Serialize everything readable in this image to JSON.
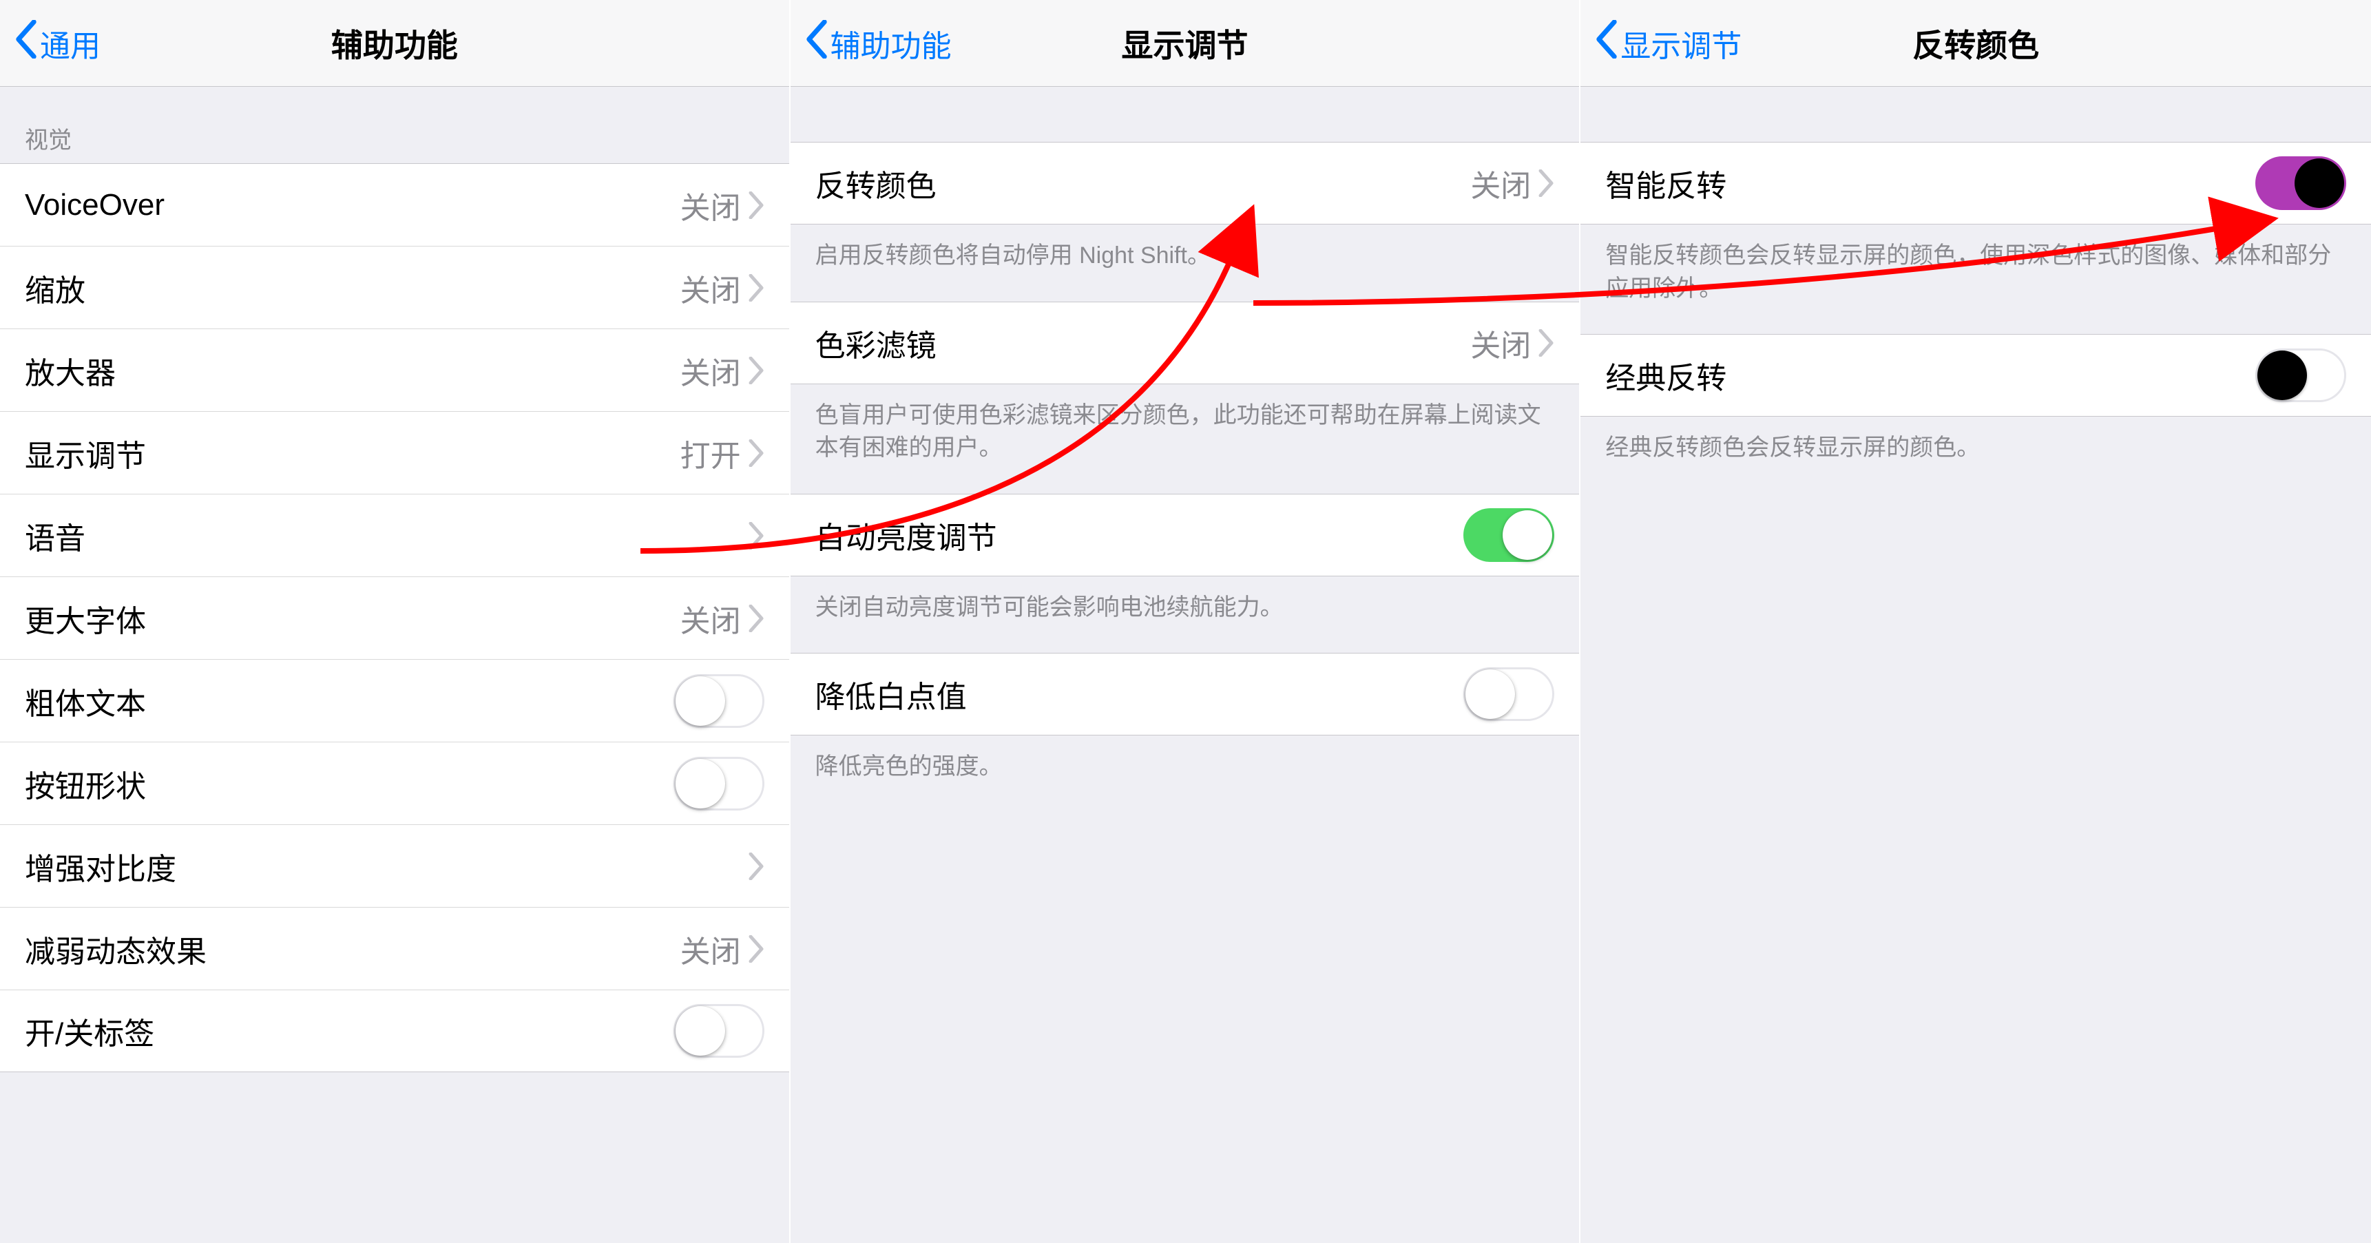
{
  "panel1": {
    "back": "通用",
    "title": "辅助功能",
    "vision_header": "视觉",
    "rows": {
      "voiceover": {
        "label": "VoiceOver",
        "value": "关闭"
      },
      "zoom": {
        "label": "缩放",
        "value": "关闭"
      },
      "magnifier": {
        "label": "放大器",
        "value": "关闭"
      },
      "display": {
        "label": "显示调节",
        "value": "打开"
      },
      "speech": {
        "label": "语音",
        "value": ""
      },
      "larger": {
        "label": "更大字体",
        "value": "关闭"
      },
      "bold": {
        "label": "粗体文本"
      },
      "buttonshape": {
        "label": "按钮形状"
      },
      "contrast": {
        "label": "增强对比度"
      },
      "motion": {
        "label": "减弱动态效果",
        "value": "关闭"
      },
      "onoff": {
        "label": "开/关标签"
      }
    }
  },
  "panel2": {
    "back": "辅助功能",
    "title": "显示调节",
    "rows": {
      "invert": {
        "label": "反转颜色",
        "value": "关闭"
      },
      "filter": {
        "label": "色彩滤镜",
        "value": "关闭"
      },
      "autobright": {
        "label": "自动亮度调节"
      },
      "whitepoint": {
        "label": "降低白点值"
      }
    },
    "notes": {
      "invert": "启用反转颜色将自动停用 Night Shift。",
      "filter": "色盲用户可使用色彩滤镜来区分颜色，此功能还可帮助在屏幕上阅读文本有困难的用户。",
      "autobright": "关闭自动亮度调节可能会影响电池续航能力。",
      "whitepoint": "降低亮色的强度。"
    }
  },
  "panel3": {
    "back": "显示调节",
    "title": "反转颜色",
    "rows": {
      "smart": {
        "label": "智能反转"
      },
      "classic": {
        "label": "经典反转"
      }
    },
    "notes": {
      "smart": "智能反转颜色会反转显示屏的颜色，使用深色样式的图像、媒体和部分应用除外。",
      "classic": "经典反转颜色会反转显示屏的颜色。"
    }
  }
}
